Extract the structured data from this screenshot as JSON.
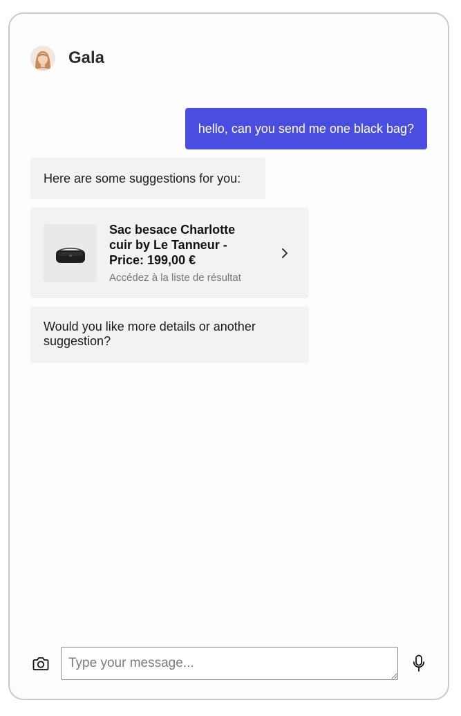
{
  "header": {
    "agent_name": "Gala",
    "avatar_icon": "woman-avatar"
  },
  "conversation": {
    "user_message": "hello, can you send me one black bag?",
    "bot_intro": "Here are some suggestions for you:",
    "product": {
      "title": "Sac besace Charlotte cuir by Le Tanneur - Price: 199,00 €",
      "subtitle": "Accédez à la liste de résultat",
      "thumbnail_icon": "black-bag-image",
      "action_icon": "chevron-right-icon"
    },
    "bot_followup": "Would you like more details or another suggestion?"
  },
  "composer": {
    "placeholder": "Type your message...",
    "left_icon": "camera-icon",
    "right_icon": "microphone-icon"
  },
  "colors": {
    "user_bubble": "#4a4ee0",
    "bot_bubble": "#f2f2f2",
    "window_border": "#c9c9c9"
  }
}
